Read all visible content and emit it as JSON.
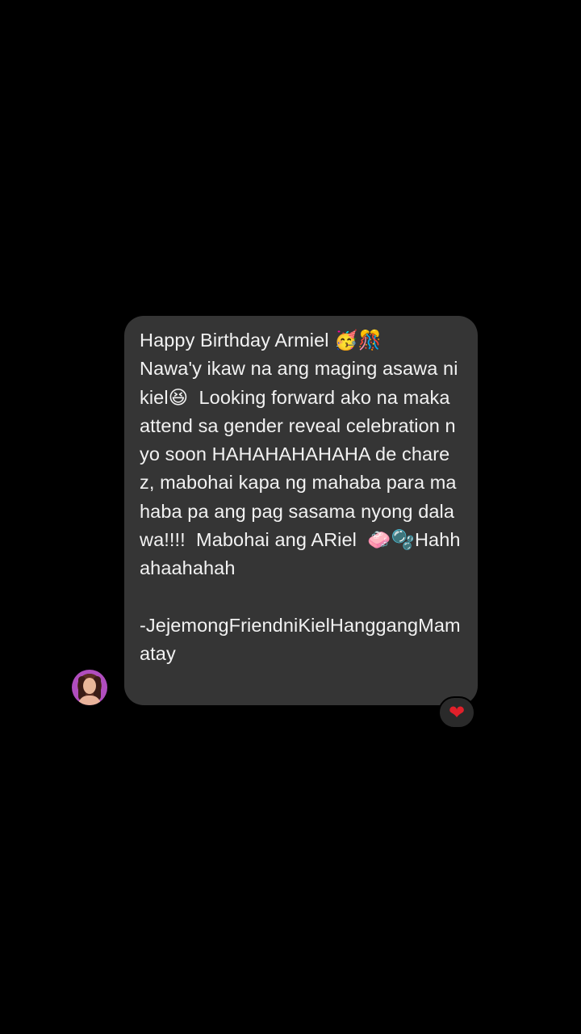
{
  "message": {
    "text": "Happy Birthday Armiel 🥳🎊\nNawa'y ikaw na ang maging asawa ni kiel😆  Looking forward ako na maka attend sa gender reveal celebration nyo soon HAHAHAHAHAHA de charez, mabohai kapa ng mahaba para mahaba pa ang pag sasama nyong dalawa!!!!  Mabohai ang ARiel  🧼🫧Hahhahaahahah\n\n-JejemongFriendniKielHanggangMamatay",
    "reaction": "❤"
  },
  "sender": {
    "avatar_icon": "profile-photo"
  },
  "colors": {
    "background": "#000000",
    "bubble": "#353535",
    "text": "#f2f2f2",
    "reaction_heart": "#e0202a"
  }
}
